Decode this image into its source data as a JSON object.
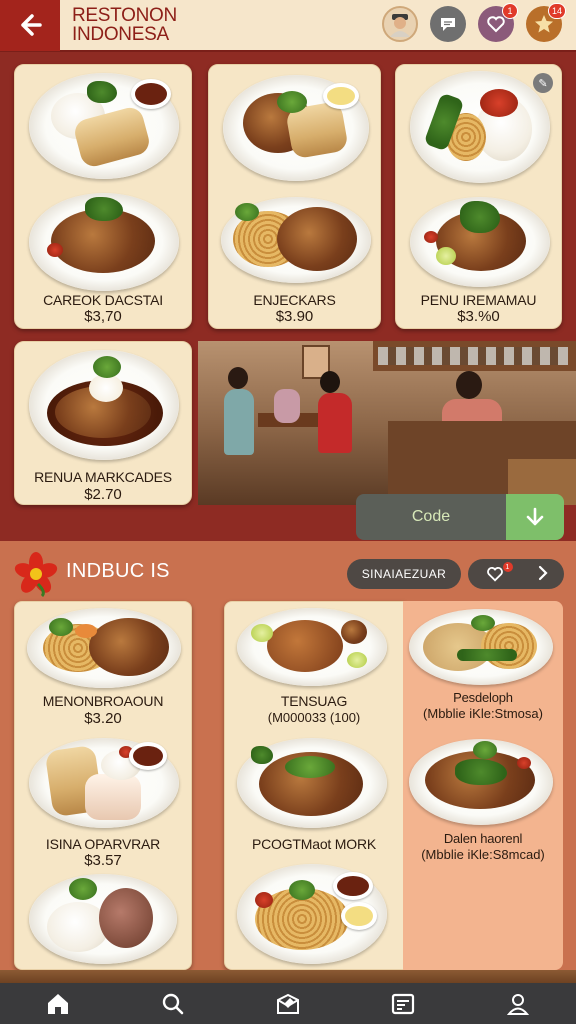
{
  "header": {
    "back_icon": "arrow-left-icon",
    "brand_line1": "RESTONON",
    "brand_line2": "INDONESA",
    "icons": [
      {
        "name": "profile-avatar-icon"
      },
      {
        "name": "chat-icon"
      },
      {
        "name": "favorites-icon",
        "badge": "1"
      },
      {
        "name": "rewards-star-icon",
        "badge": "14"
      }
    ]
  },
  "top_menu": [
    {
      "name": "CAREOK DACSTAI",
      "price": "$3,70"
    },
    {
      "name": "ENJECKARS",
      "price": "$3.90"
    },
    {
      "name": "PENU IREMAMAU",
      "price": "$3.%0"
    },
    {
      "name": "RENUA MARKCADES",
      "price": "$2.70"
    }
  ],
  "code_prompt": {
    "label": "Code",
    "button_icon": "arrow-down-icon"
  },
  "section": {
    "title": "INDBUC IS",
    "icon": "flower-icon",
    "pill_label": "SINAIAEZUAR",
    "pill2_badge": "1",
    "pill2_icons": [
      "favorites-icon",
      "chevron-right-icon"
    ]
  },
  "lower_menu": {
    "left": [
      {
        "name": "MENONBROAOUN",
        "price": "$3.20"
      },
      {
        "name": "ISINA OPARVRAR",
        "price": "$3.57"
      }
    ],
    "middle": [
      {
        "name": "TENSUAG",
        "sub": "(M000033 (100)"
      },
      {
        "name": "PCOGTMaot MORK"
      }
    ],
    "right": [
      {
        "name": "Pesdeloph",
        "sub": "(Mbblie iKle:Stmosa)"
      },
      {
        "name": "Dalen haorenl",
        "sub": "(Mbblie iKle:S8mcad)"
      }
    ]
  },
  "bottom_nav": [
    {
      "name": "home-icon"
    },
    {
      "name": "search-icon"
    },
    {
      "name": "menu-icon"
    },
    {
      "name": "orders-icon"
    },
    {
      "name": "profile-icon"
    }
  ],
  "colors": {
    "brand_red": "#a3241c",
    "background": "#8e2b23",
    "card": "#f6e6c6",
    "lower_section": "#c9714f",
    "accent_green": "#7ebf6a"
  }
}
